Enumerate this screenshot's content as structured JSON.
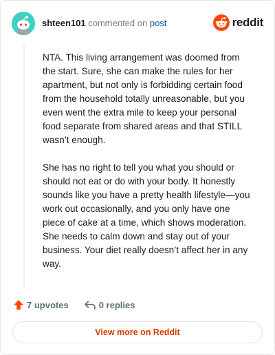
{
  "header": {
    "username": "shteen101",
    "commented_text": "commented on",
    "post_link": "post",
    "logo_text": "reddit"
  },
  "comment": {
    "paragraphs": [
      "NTA. This living arrangement was doomed from the start. Sure, she can make the rules for her apartment, but not only is forbidding certain food from the household totally unreasonable, but you even went the extra mile to keep your personal food separate from shared areas and that STILL wasn’t enough.",
      "She has no right to tell you what you should or should not eat or do with your body. It honestly sounds like you have a pretty health lifestyle—you work out occasionally, and you only have one piece of cake at a time, which shows moderation. She needs to calm down and stay out of your business. Your diet really doesn’t affect her in any way."
    ]
  },
  "actions": {
    "upvotes": "7 upvotes",
    "replies": "0 replies"
  },
  "footer": {
    "view_more": "View more on Reddit"
  },
  "icons": {
    "avatar": "snoo-avatar-icon",
    "logo": "reddit-logo-icon",
    "upvote": "upvote-arrow-icon",
    "reply": "reply-arrow-icon"
  },
  "colors": {
    "brand": "#ff4500",
    "upvote": "#ff4500",
    "link": "#0f4ea0",
    "view_more_text": "#d93900",
    "avatar_bg": "#3fd0c3",
    "muted": "#576f76"
  }
}
